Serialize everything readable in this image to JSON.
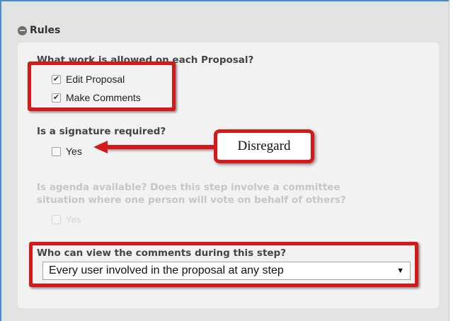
{
  "section": {
    "title": "Rules",
    "icon": "collapse-icon"
  },
  "work_allowed": {
    "question": "What work is allowed on each Proposal?",
    "options": [
      {
        "label": "Edit Proposal",
        "checked": true
      },
      {
        "label": "Make Comments",
        "checked": true
      }
    ]
  },
  "signature": {
    "question": "Is a signature required?",
    "option": {
      "label": "Yes",
      "checked": false
    }
  },
  "agenda": {
    "question_line1": "Is agenda available? Does this step involve a committee",
    "question_line2": "situation where one person will vote on behalf of others?",
    "option": {
      "label": "Yes",
      "checked": false,
      "disabled": true
    }
  },
  "view_comments": {
    "question": "Who can view the comments during this step?",
    "selected": "Every user involved in the proposal at any step"
  },
  "annotation": {
    "callout_text": "Disregard",
    "color": "#d61818"
  }
}
